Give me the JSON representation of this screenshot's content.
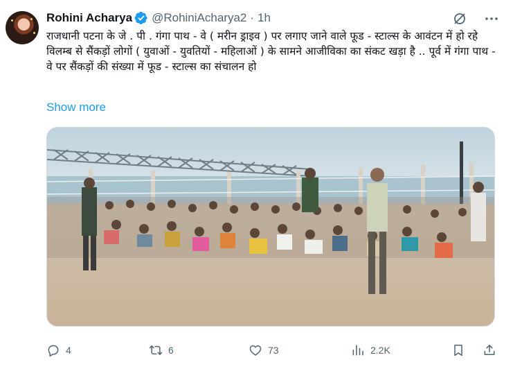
{
  "tweet": {
    "display_name": "Rohini Acharya",
    "handle": "@RohiniAcharya2",
    "separator": "·",
    "time": "1h",
    "text": "राजधानी पटना के जे . पी . गंगा पाथ - वे ( मरीन ड्राइव ) पर लगाए जाने वाले फूड - स्टाल्स के आवंटन में हो रहे विलम्ब से सैंकड़ों लोगों ( युवाओं - युवतियों - महिलाओं ) के सामने आजीविका का संकट खड़ा है .. पूर्व में गंगा पाथ - वे पर सैंकड़ों की संख्या में फूड - स्टाल्स का संचालन हो",
    "show_more": "Show more"
  },
  "actions": {
    "replies": "4",
    "reposts": "6",
    "likes": "73",
    "views": "2.2K"
  },
  "icons": {
    "verified": "verified-badge-icon",
    "grok": "grok-icon",
    "more": "more-icon",
    "reply": "reply-icon",
    "repost": "repost-icon",
    "like": "heart-icon",
    "views": "views-icon",
    "bookmark": "bookmark-icon",
    "share": "share-icon"
  },
  "colors": {
    "accent": "#1d9bf0",
    "text": "#0f1419",
    "secondary": "#536471",
    "border": "#cfd9de"
  }
}
